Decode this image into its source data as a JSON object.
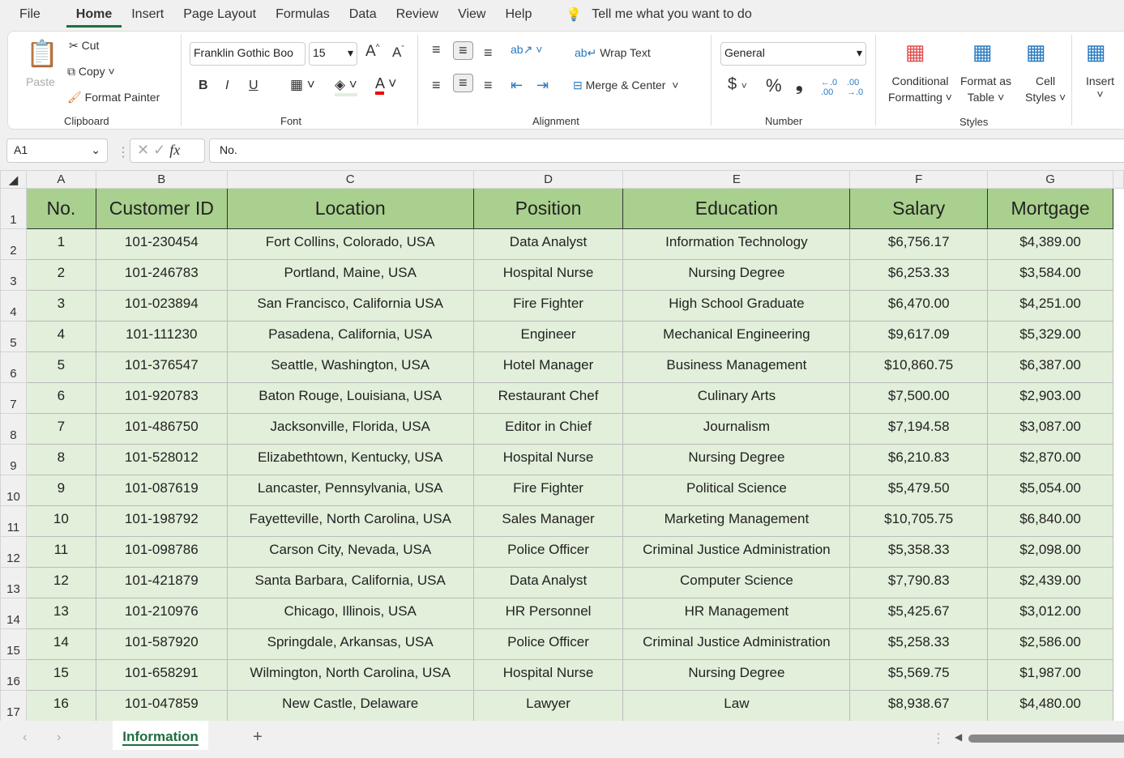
{
  "menu": [
    "File",
    "Home",
    "Insert",
    "Page Layout",
    "Formulas",
    "Data",
    "Review",
    "View",
    "Help"
  ],
  "tell_me": "Tell me what you want to do",
  "clipboard": {
    "paste": "Paste",
    "cut": "Cut",
    "copy": "Copy",
    "format_painter": "Format Painter",
    "label": "Clipboard"
  },
  "font": {
    "name": "Franklin Gothic Boo",
    "size": "15",
    "bold": "B",
    "italic": "I",
    "underline": "U",
    "label": "Font"
  },
  "alignment": {
    "wrap": "Wrap Text",
    "merge": "Merge & Center",
    "label": "Alignment"
  },
  "number": {
    "format": "General",
    "currency": "$",
    "percent": "%",
    "comma": "❟",
    "label": "Number"
  },
  "styles": {
    "conditional": [
      "Conditional",
      "Formatting"
    ],
    "format_table": [
      "Format as",
      "Table"
    ],
    "cell_styles": [
      "Cell",
      "Styles"
    ],
    "label": "Styles"
  },
  "cells": {
    "insert": "Insert"
  },
  "formula_bar": {
    "name_box": "A1",
    "fx": "fx",
    "value": "No."
  },
  "columns": [
    "A",
    "B",
    "C",
    "D",
    "E",
    "F",
    "G"
  ],
  "headers": [
    "No.",
    "Customer ID",
    "Location",
    "Position",
    "Education",
    "Salary",
    "Mortgage"
  ],
  "rows": [
    [
      "1",
      "101-230454",
      "Fort Collins, Colorado, USA",
      "Data Analyst",
      "Information Technology",
      "$6,756.17",
      "$4,389.00"
    ],
    [
      "2",
      "101-246783",
      "Portland, Maine, USA",
      "Hospital Nurse",
      "Nursing Degree",
      "$6,253.33",
      "$3,584.00"
    ],
    [
      "3",
      "101-023894",
      "San Francisco, California USA",
      "Fire Fighter",
      "High School Graduate",
      "$6,470.00",
      "$4,251.00"
    ],
    [
      "4",
      "101-111230",
      "Pasadena, California, USA",
      "Engineer",
      "Mechanical Engineering",
      "$9,617.09",
      "$5,329.00"
    ],
    [
      "5",
      "101-376547",
      "Seattle, Washington, USA",
      "Hotel Manager",
      "Business Management",
      "$10,860.75",
      "$6,387.00"
    ],
    [
      "6",
      "101-920783",
      "Baton Rouge, Louisiana, USA",
      "Restaurant Chef",
      "Culinary Arts",
      "$7,500.00",
      "$2,903.00"
    ],
    [
      "7",
      "101-486750",
      "Jacksonville, Florida, USA",
      "Editor in Chief",
      "Journalism",
      "$7,194.58",
      "$3,087.00"
    ],
    [
      "8",
      "101-528012",
      "Elizabethtown, Kentucky, USA",
      "Hospital Nurse",
      "Nursing Degree",
      "$6,210.83",
      "$2,870.00"
    ],
    [
      "9",
      "101-087619",
      "Lancaster, Pennsylvania, USA",
      "Fire Fighter",
      "Political Science",
      "$5,479.50",
      "$5,054.00"
    ],
    [
      "10",
      "101-198792",
      "Fayetteville, North Carolina, USA",
      "Sales Manager",
      "Marketing Management",
      "$10,705.75",
      "$6,840.00"
    ],
    [
      "11",
      "101-098786",
      "Carson City, Nevada, USA",
      "Police Officer",
      "Criminal Justice Administration",
      "$5,358.33",
      "$2,098.00"
    ],
    [
      "12",
      "101-421879",
      "Santa Barbara, California, USA",
      "Data Analyst",
      "Computer Science",
      "$7,790.83",
      "$2,439.00"
    ],
    [
      "13",
      "101-210976",
      "Chicago, Illinois, USA",
      "HR Personnel",
      "HR Management",
      "$5,425.67",
      "$3,012.00"
    ],
    [
      "14",
      "101-587920",
      "Springdale, Arkansas, USA",
      "Police Officer",
      "Criminal Justice Administration",
      "$5,258.33",
      "$2,586.00"
    ],
    [
      "15",
      "101-658291",
      "Wilmington, North Carolina, USA",
      "Hospital Nurse",
      "Nursing Degree",
      "$5,569.75",
      "$1,987.00"
    ],
    [
      "16",
      "101-047859",
      "New Castle, Delaware",
      "Lawyer",
      "Law",
      "$8,938.67",
      "$4,480.00"
    ]
  ],
  "sheet_tab": "Information",
  "add_sheet": "+"
}
